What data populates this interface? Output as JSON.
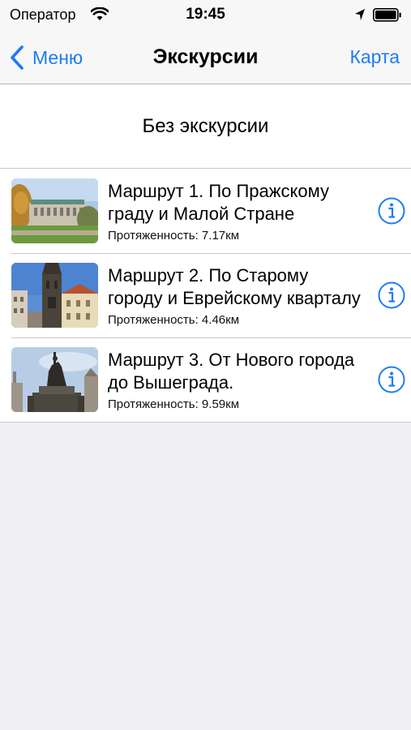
{
  "status_bar": {
    "carrier": "Оператор",
    "time": "19:45"
  },
  "nav": {
    "back_label": "Меню",
    "title": "Экскурсии",
    "right_label": "Карта"
  },
  "no_tour_label": "Без экскурсии",
  "routes": [
    {
      "title": "Маршрут 1. По Пражскому граду и Малой Стране",
      "length_label": "Протяженность: 7.17км"
    },
    {
      "title": "Маршрут 2. По Старому городу и Еврейскому кварталу",
      "length_label": "Протяженность: 4.46км"
    },
    {
      "title": "Маршрут 3. От Нового города до Вышеграда.",
      "length_label": "Протяженность: 9.59км"
    }
  ],
  "colors": {
    "accent": "#1e7cf2",
    "background": "#efeff4"
  },
  "icons": [
    "wifi-icon",
    "location-arrow-icon",
    "battery-icon",
    "chevron-left-icon",
    "info-icon"
  ]
}
